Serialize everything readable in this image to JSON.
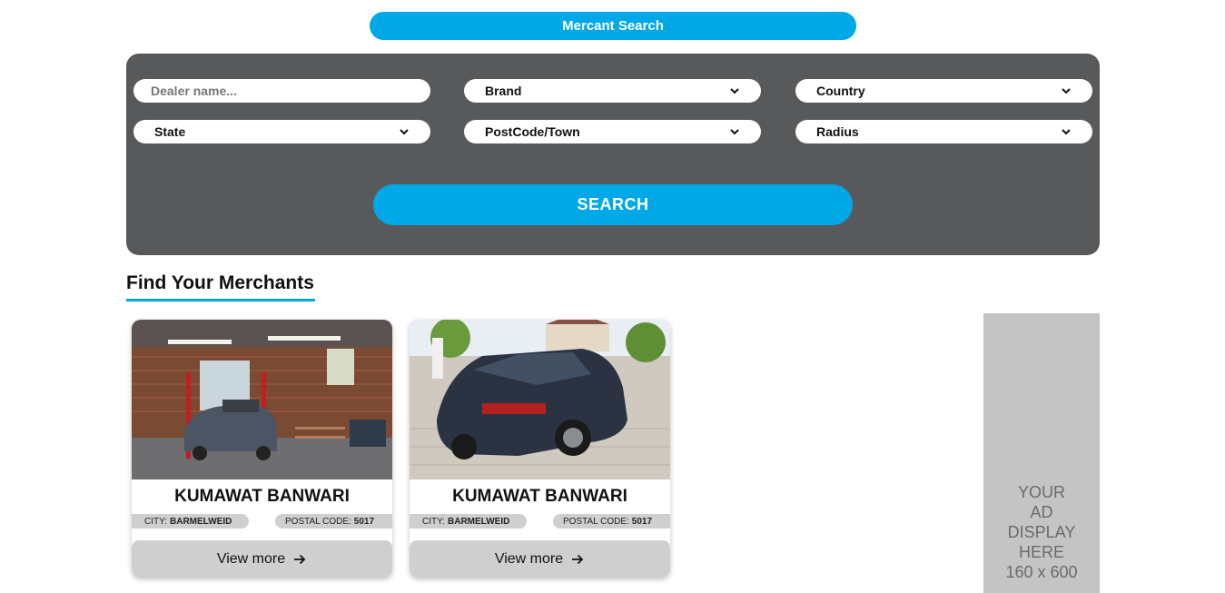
{
  "header": {
    "title": "Mercant Search"
  },
  "search": {
    "dealer_placeholder": "Dealer name...",
    "brand_label": "Brand",
    "country_label": "Country",
    "state_label": "State",
    "postcode_label": "PostCode/Town",
    "radius_label": "Radius",
    "submit_label": "SEARCH"
  },
  "section": {
    "title": "Find Your Merchants"
  },
  "merchants": [
    {
      "name": "KUMAWAT BANWARI",
      "city_label": "CITY:",
      "city": "BARMELWEID",
      "postal_label": "POSTAL CODE:",
      "postal": "5017",
      "view_more": "View more",
      "photo": "garage-workshop"
    },
    {
      "name": "KUMAWAT BANWARI",
      "city_label": "CITY:",
      "city": "BARMELWEID",
      "postal_label": "POSTAL CODE:",
      "postal": "5017",
      "view_more": "View more",
      "photo": "station-wagon-car"
    }
  ],
  "ad": {
    "lines": [
      "YOUR",
      "AD",
      "DISPLAY",
      "HERE",
      "160 x 600"
    ]
  },
  "colors": {
    "accent": "#00a8e8",
    "panel": "#58595b",
    "badge": "#cfcfcf",
    "ad_bg": "#c4c4c4"
  }
}
